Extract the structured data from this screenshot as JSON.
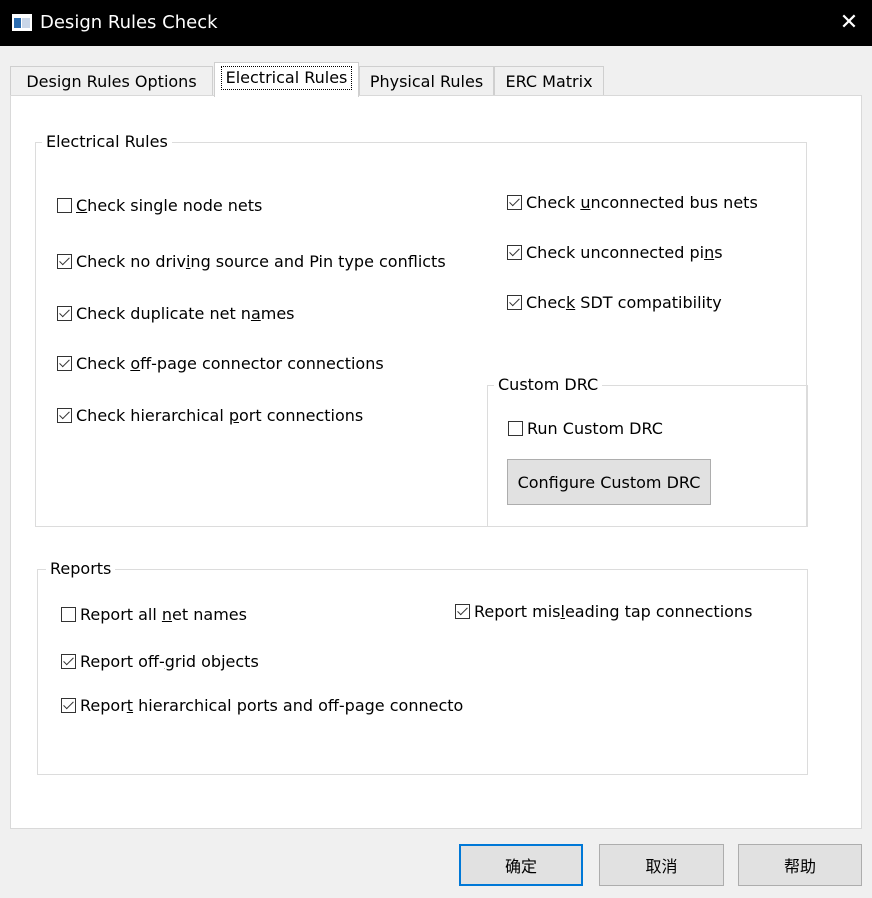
{
  "window": {
    "title": "Design Rules Check",
    "close_glyph": "✕"
  },
  "tabs": [
    {
      "label": "Design Rules Options"
    },
    {
      "label": "Electrical Rules"
    },
    {
      "label": "Physical Rules"
    },
    {
      "label": "ERC Matrix"
    }
  ],
  "electrical_rules": {
    "legend": "Electrical Rules",
    "left": [
      {
        "label": "Check single node nets",
        "checked": false,
        "ul": 0
      },
      {
        "label": "Check no driving source and Pin type conflicts",
        "checked": true,
        "ul": 13
      },
      {
        "label": "Check duplicate net names",
        "checked": true,
        "ul": 21
      },
      {
        "label": "Check off-page connector connections",
        "checked": true,
        "ul": 6
      },
      {
        "label": "Check hierarchical port connections",
        "checked": true,
        "ul": 19
      }
    ],
    "right": [
      {
        "label": "Check unconnected bus nets",
        "checked": true,
        "ul": 6
      },
      {
        "label": "Check unconnected pins",
        "checked": true,
        "ul": 20
      },
      {
        "label": "Check SDT compatibility",
        "checked": true,
        "ul": 4
      }
    ]
  },
  "custom_drc": {
    "legend": "Custom DRC",
    "run_label": "Run Custom DRC",
    "run_checked": false,
    "configure_label": "Configure Custom DRC"
  },
  "reports": {
    "legend": "Reports",
    "left": [
      {
        "label": "Report all net names",
        "checked": false,
        "ul": 11
      },
      {
        "label": "Report off-grid objects",
        "checked": true,
        "ul": 11
      },
      {
        "label": "Report hierarchical ports and off-page connecto",
        "checked": true,
        "ul": 5
      }
    ],
    "right": [
      {
        "label": "Report misleading tap connections",
        "checked": true,
        "ul": 10
      }
    ]
  },
  "buttons": {
    "ok": "确定",
    "cancel": "取消",
    "help": "帮助"
  }
}
